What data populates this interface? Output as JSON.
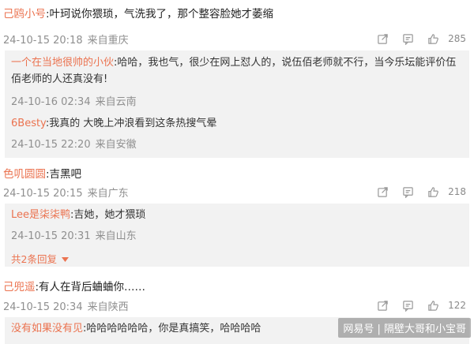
{
  "comments": [
    {
      "user": "己鸥小号",
      "text": ":叶珂说你猥琐，气洗我了，那个整容脸她才萎缩",
      "time": "24-10-15 20:18",
      "location": "来自重庆",
      "likes": "285",
      "replies": [
        {
          "user": "一个在当地很帅的小伙",
          "text": ":哈哈，我也气，很少在网上怼人的，说伍佰老师就不行，当今乐坛能评价伍佰老师的人还真没有!",
          "time": "24-10-16 02:34",
          "location": "来自云南"
        },
        {
          "user": "6Besty",
          "text": ":我真的 大晚上冲浪看到这条热搜气晕",
          "time": "24-10-15 22:20",
          "location": "来自安徽"
        }
      ]
    },
    {
      "user": "色叽圆圆",
      "text": ":吉黑吧",
      "time": "24-10-15 20:15",
      "location": "来自广东",
      "likes": "218",
      "replies": [
        {
          "user": "Lee是柒柒鸭",
          "text": ":吉她，她才猥琐",
          "time": "24-10-15 20:31",
          "location": "来自山东"
        }
      ],
      "more_replies": "共2条回复"
    },
    {
      "user": "己兜遥",
      "text": ":有人在背后蛐蛐你……",
      "time": "24-10-15 20:34",
      "location": "来自陕西",
      "likes": "122",
      "replies": [
        {
          "user": "没有如果没有见",
          "text": ":哈哈哈哈哈哈，你是真搞笑，哈哈哈哈"
        }
      ]
    }
  ],
  "watermark": "网易号 | 隔壁大哥和小宝哥",
  "colors": {
    "username": "#eb7350",
    "meta": "#8f8f8f",
    "reply_bg": "#f2f2f2"
  },
  "icons": [
    "share-icon",
    "comment-icon",
    "like-icon",
    "chevron-down-icon"
  ]
}
